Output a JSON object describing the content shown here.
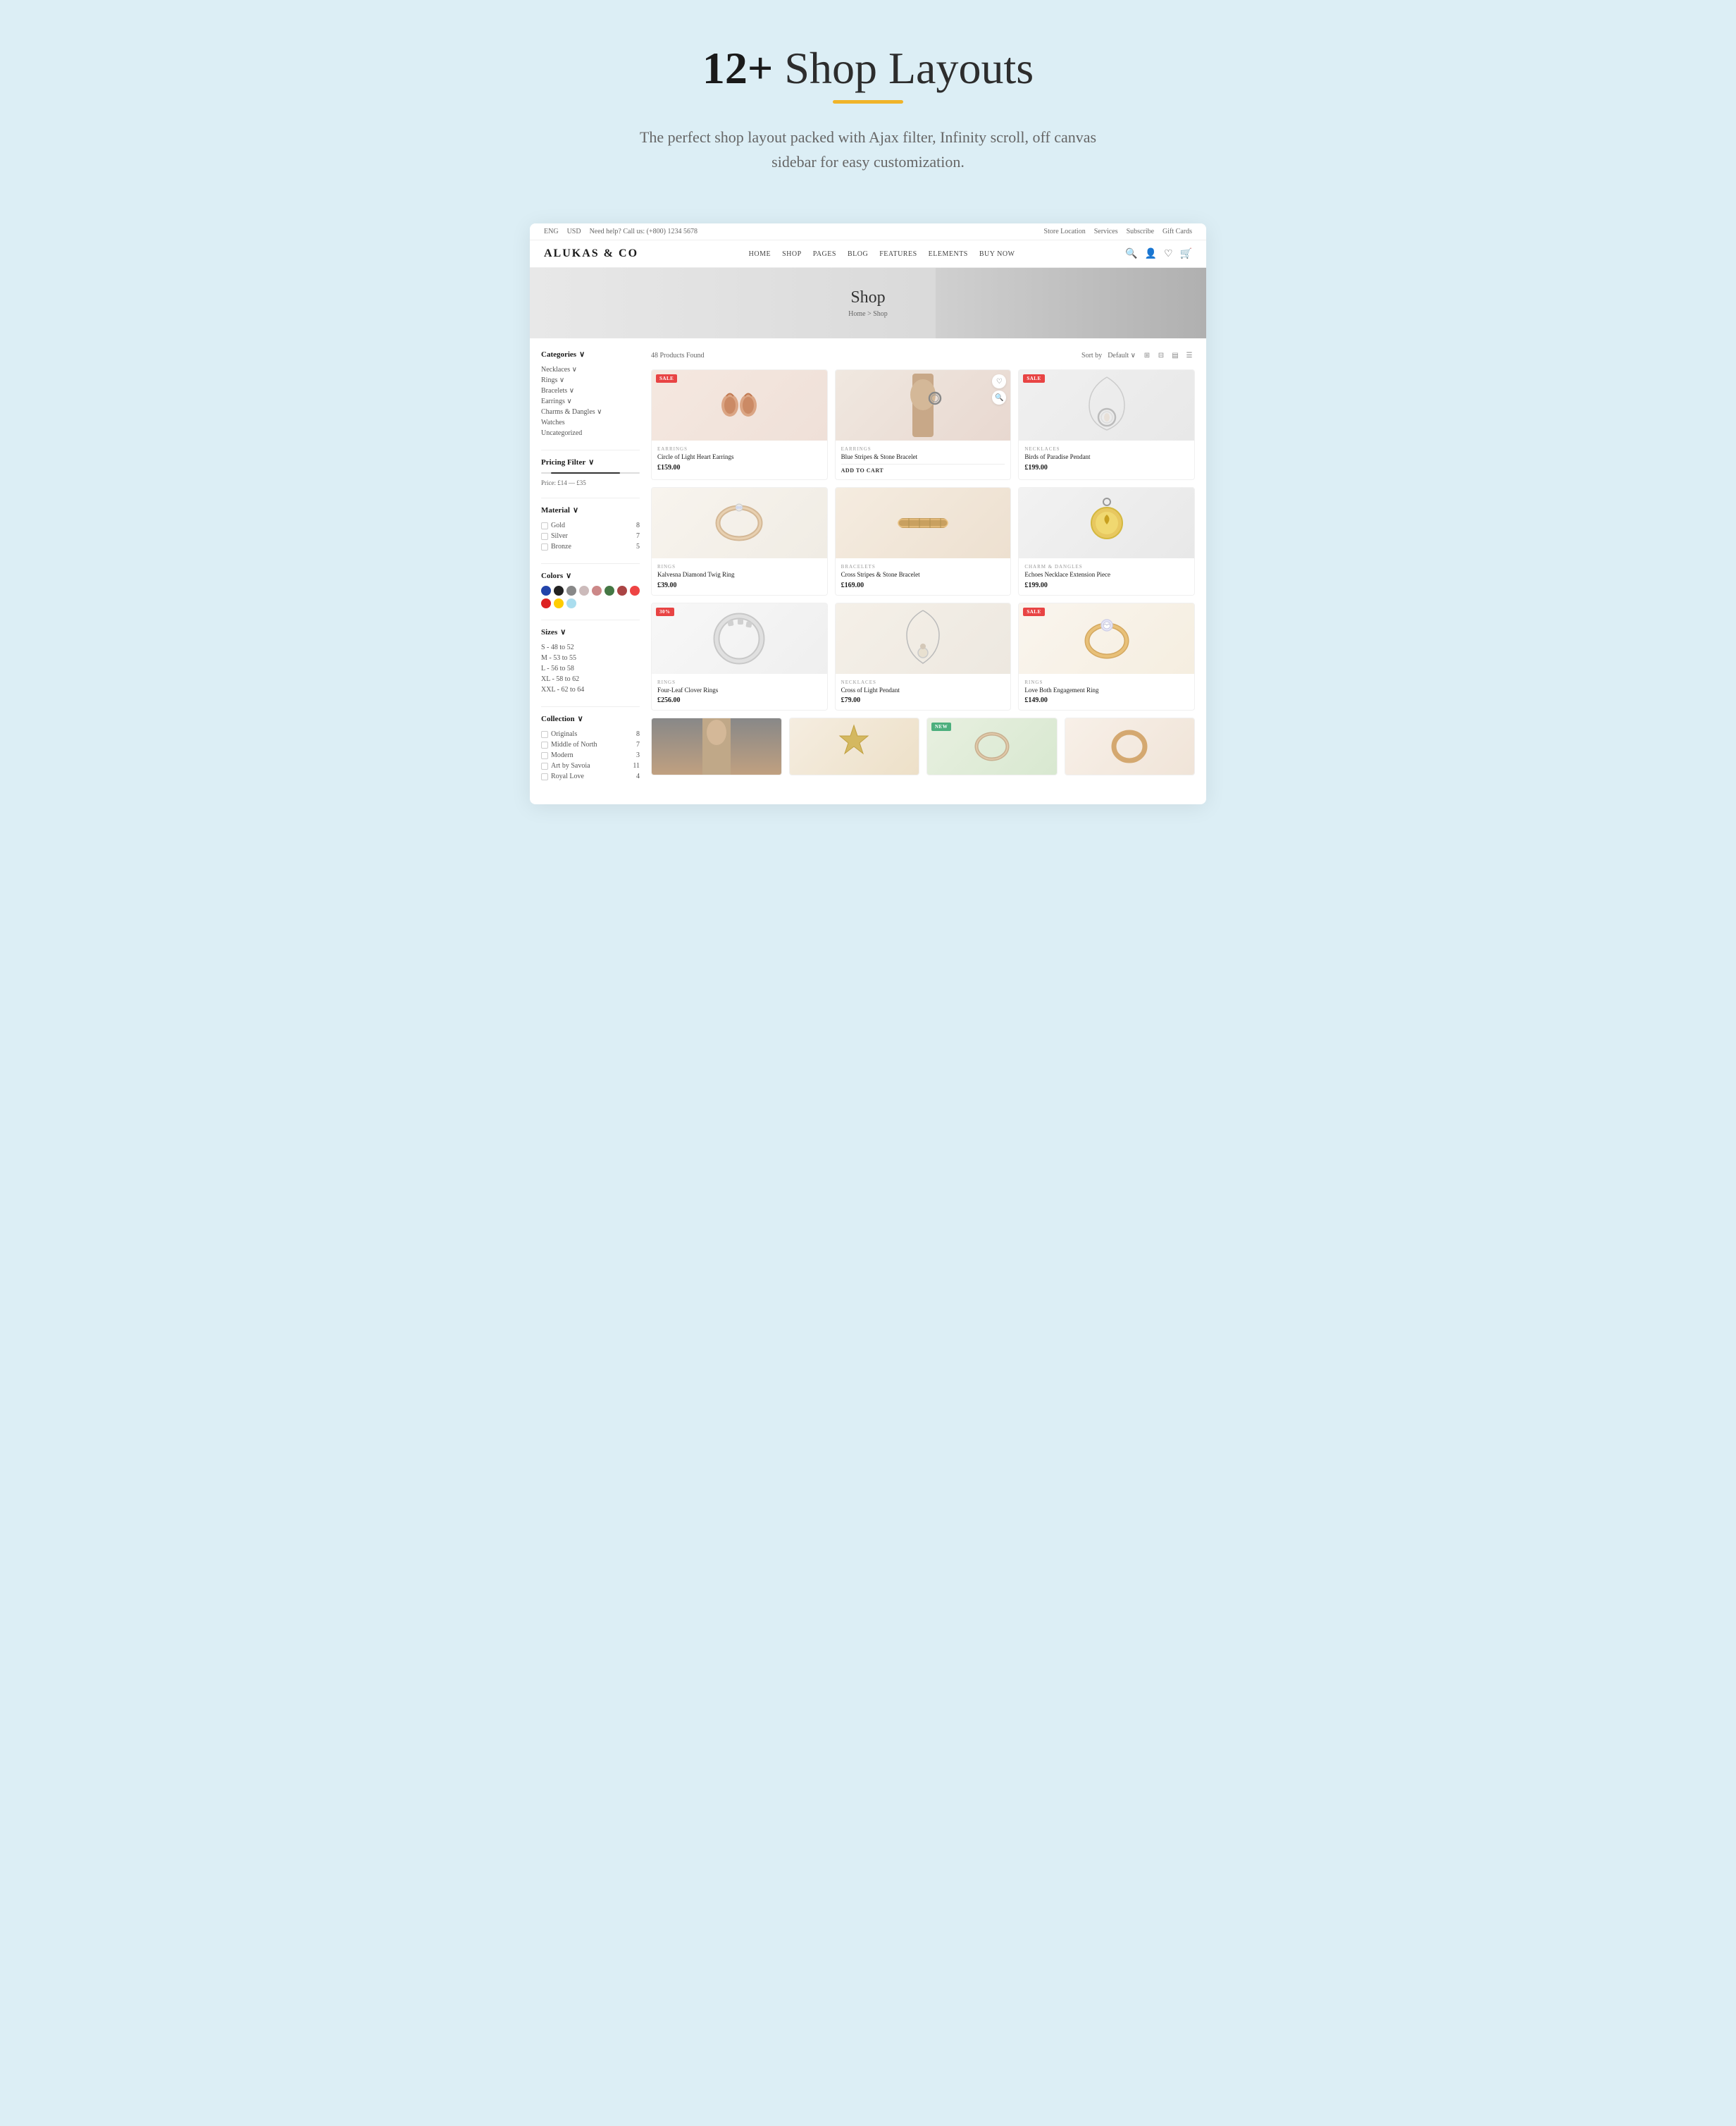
{
  "hero": {
    "title_prefix": "12+",
    "title_suffix": " Shop Layouts",
    "subtitle": "The perfect shop layout packed with Ajax filter, Infinity scroll, off canvas sidebar for easy customization."
  },
  "topbar": {
    "left": {
      "lang": "ENG",
      "currency": "USD",
      "phone_label": "Need help? Call us:",
      "phone": "(+800) 1234 5678"
    },
    "right": {
      "store_location": "Store Location",
      "services": "Services",
      "subscribe": "Subscribe",
      "gift_cards": "Gift Cards"
    }
  },
  "nav": {
    "logo": "ALUKAS & CO",
    "links": [
      "HOME",
      "SHOP",
      "PAGES",
      "BLOG",
      "FEATURES",
      "ELEMENTS",
      "BUY NOW"
    ]
  },
  "banner": {
    "title": "Shop",
    "breadcrumb": "Home > Shop"
  },
  "sidebar": {
    "categories_label": "Categories",
    "categories": [
      {
        "name": "Necklaces",
        "has_arrow": true
      },
      {
        "name": "Rings",
        "has_arrow": true
      },
      {
        "name": "Bracelets",
        "has_arrow": true
      },
      {
        "name": "Earrings",
        "has_arrow": true
      },
      {
        "name": "Charms & Dangles",
        "has_arrow": true
      },
      {
        "name": "Watches"
      },
      {
        "name": "Uncategorized"
      }
    ],
    "pricing_label": "Pricing Filter",
    "price_range": "Price: £14 — £35",
    "material_label": "Material",
    "materials": [
      {
        "name": "Gold",
        "count": 8
      },
      {
        "name": "Silver",
        "count": 7
      },
      {
        "name": "Bronze",
        "count": 5
      }
    ],
    "colors_label": "Colors",
    "colors": [
      "#2244aa",
      "#222222",
      "#888888",
      "#ccbbbb",
      "#cc8888",
      "#447744",
      "#aa4444",
      "#ee4444",
      "#dd2222",
      "#ffcc00",
      "#aaddee"
    ],
    "sizes_label": "Sizes",
    "sizes": [
      "S - 48 to 52",
      "M - 53 to 55",
      "L - 56 to 58",
      "XL - 58 to 62",
      "XXL - 62 to 64"
    ],
    "collection_label": "Collection",
    "collections": [
      {
        "name": "Originals",
        "count": 8
      },
      {
        "name": "Middle of North",
        "count": 7
      },
      {
        "name": "Modern",
        "count": 3
      },
      {
        "name": "Art by Savoia",
        "count": 11
      },
      {
        "name": "Royal Love",
        "count": 4
      }
    ]
  },
  "product_area": {
    "count_label": "48 Products Found",
    "sort_label": "Sort by",
    "sort_default": "Default",
    "products": [
      {
        "id": 1,
        "badge": "SALE",
        "badge_type": "sale",
        "category": "EARRINGS",
        "name": "Circle of Light Heart Earrings",
        "price": "£159.00",
        "image_type": "earrings-rose"
      },
      {
        "id": 2,
        "badge": "",
        "badge_type": "",
        "category": "EARRINGS",
        "name": "Blue Stripes & Stone Bracelet",
        "price": "",
        "add_to_cart": "ADD TO CART",
        "image_type": "earrings-hoop"
      },
      {
        "id": 3,
        "badge": "SALE",
        "badge_type": "sale",
        "category": "NECKLACES",
        "name": "Birds of Paradise Pendant",
        "price": "£199.00",
        "image_type": "necklace-pendant"
      },
      {
        "id": 4,
        "badge": "",
        "badge_type": "",
        "category": "RINGS",
        "name": "Kalvesna Diamond Twig Ring",
        "price": "£39.00",
        "image_type": "ring-diamond"
      },
      {
        "id": 5,
        "badge": "",
        "badge_type": "",
        "category": "BRACELETS",
        "name": "Cross Stripes & Stone Bracelet",
        "price": "£169.00",
        "image_type": "bracelet-cross"
      },
      {
        "id": 6,
        "badge": "",
        "badge_type": "",
        "category": "CHARM & DANGLES",
        "name": "Echoes Necklace Extension Piece",
        "price": "£199.00",
        "image_type": "charm-heart"
      },
      {
        "id": 7,
        "badge": "30%",
        "badge_type": "pct",
        "category": "RINGS",
        "name": "Four-Leaf Clover Rings",
        "price": "£256.00",
        "image_type": "ring-clover"
      },
      {
        "id": 8,
        "badge": "",
        "badge_type": "",
        "category": "NECKLACES",
        "name": "Cross of Light Pendant",
        "price": "£79.00",
        "image_type": "necklace-cross"
      },
      {
        "id": 9,
        "badge": "SALE",
        "badge_type": "sale",
        "category": "RINGS",
        "name": "Love Both Engagement Ring",
        "price": "£149.00",
        "image_type": "ring-engagement"
      }
    ],
    "bottom_partial": [
      {
        "id": 10,
        "badge": "",
        "badge_type": "",
        "image_type": "person"
      },
      {
        "id": 11,
        "badge": "",
        "badge_type": ""
      },
      {
        "id": 12,
        "badge": "NEW",
        "badge_type": "new"
      },
      {
        "id": 13,
        "badge": "",
        "badge_type": ""
      }
    ]
  }
}
